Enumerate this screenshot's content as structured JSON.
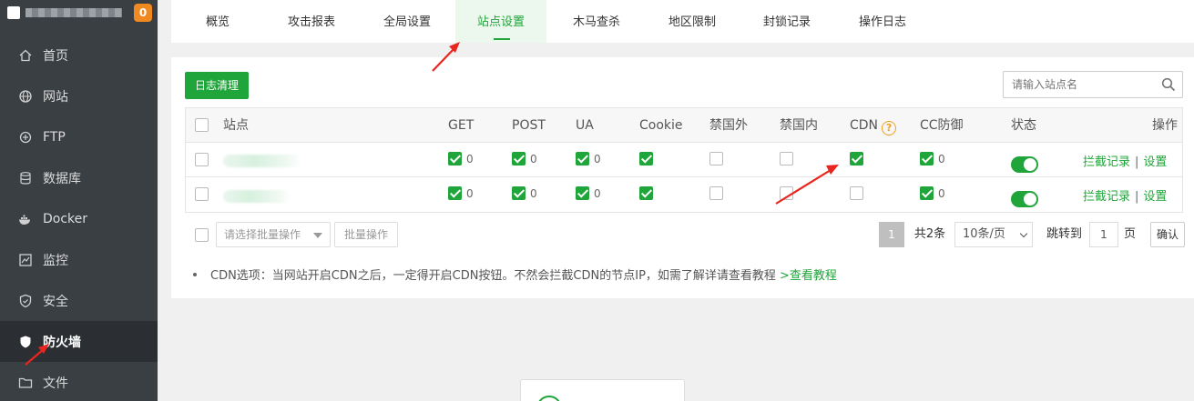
{
  "sidebar": {
    "badge": "0",
    "items": [
      {
        "label": "首页",
        "icon": "home-icon"
      },
      {
        "label": "网站",
        "icon": "globe-icon"
      },
      {
        "label": "FTP",
        "icon": "ftp-icon"
      },
      {
        "label": "数据库",
        "icon": "database-icon"
      },
      {
        "label": "Docker",
        "icon": "docker-icon"
      },
      {
        "label": "监控",
        "icon": "monitor-icon"
      },
      {
        "label": "安全",
        "icon": "shield-icon"
      },
      {
        "label": "防火墙",
        "icon": "firewall-icon",
        "active": true
      },
      {
        "label": "文件",
        "icon": "folder-icon"
      }
    ]
  },
  "tabs": [
    {
      "label": "概览"
    },
    {
      "label": "攻击报表"
    },
    {
      "label": "全局设置"
    },
    {
      "label": "站点设置",
      "active": true
    },
    {
      "label": "木马查杀"
    },
    {
      "label": "地区限制"
    },
    {
      "label": "封锁记录"
    },
    {
      "label": "操作日志"
    }
  ],
  "toolbar": {
    "clear_log": "日志清理",
    "search_placeholder": "请输入站点名"
  },
  "table": {
    "headers": {
      "site": "站点",
      "get": "GET",
      "post": "POST",
      "ua": "UA",
      "cookie": "Cookie",
      "ban_foreign": "禁国外",
      "ban_domestic": "禁国内",
      "cdn": "CDN",
      "cc": "CC防御",
      "status": "状态",
      "ops": "操作"
    },
    "rows": [
      {
        "get": true,
        "get_count": "0",
        "post": true,
        "post_count": "0",
        "ua": true,
        "ua_count": "0",
        "cookie": true,
        "ban_foreign": false,
        "ban_domestic": false,
        "cdn": true,
        "cc": true,
        "cc_count": "0",
        "status": true,
        "op_log": "拦截记录",
        "op_settings": "设置"
      },
      {
        "get": true,
        "get_count": "0",
        "post": true,
        "post_count": "0",
        "ua": true,
        "ua_count": "0",
        "cookie": true,
        "ban_foreign": false,
        "ban_domestic": false,
        "cdn": false,
        "cc": true,
        "cc_count": "0",
        "status": true,
        "op_log": "拦截记录",
        "op_settings": "设置"
      }
    ]
  },
  "batch": {
    "select_placeholder": "请选择批量操作",
    "button": "批量操作"
  },
  "pagination": {
    "current": "1",
    "total": "共2条",
    "page_size": "10条/页",
    "jump_label": "跳转到",
    "jump_value": "1",
    "page_unit": "页",
    "confirm": "确认"
  },
  "note": {
    "text": "CDN选项：当网站开启CDN之后，一定得开启CDN按钮。不然会拦截CDN的节点IP，如需了解详请查看教程",
    "link": ">查看教程"
  },
  "colors": {
    "accent": "#20a53a",
    "sidebar_bg": "#3a3f44",
    "badge": "#f0891f",
    "annotation_arrow": "#e8251e"
  }
}
